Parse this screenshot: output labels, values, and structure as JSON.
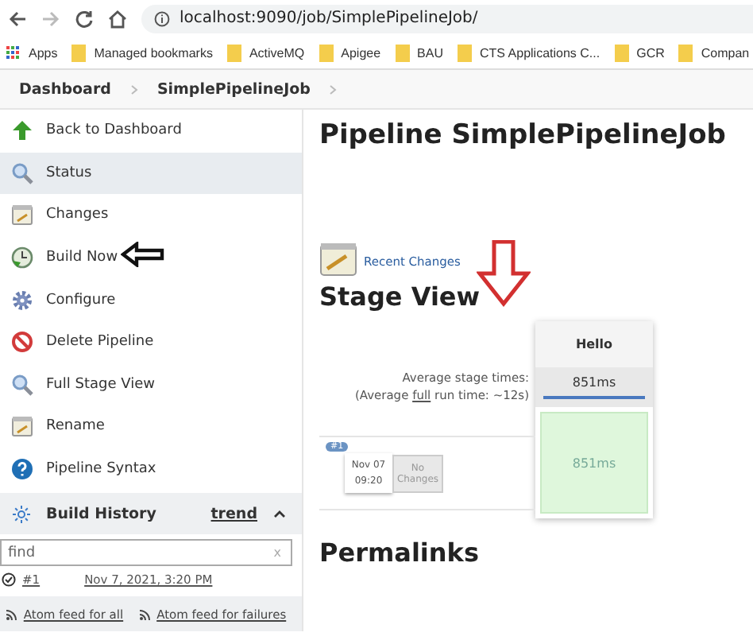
{
  "browser": {
    "url": "localhost:9090/job/SimplePipelineJob/"
  },
  "bookmarks": [
    {
      "label": "Apps",
      "kind": "apps"
    },
    {
      "label": "Managed bookmarks",
      "kind": "folder"
    },
    {
      "label": "ActiveMQ",
      "kind": "folder"
    },
    {
      "label": "Apigee",
      "kind": "folder"
    },
    {
      "label": "BAU",
      "kind": "folder"
    },
    {
      "label": "CTS Applications C...",
      "kind": "folder"
    },
    {
      "label": "GCR",
      "kind": "folder"
    },
    {
      "label": "Compan",
      "kind": "folder"
    }
  ],
  "breadcrumbs": [
    "Dashboard",
    "SimplePipelineJob"
  ],
  "sidebar": {
    "items": [
      {
        "label": "Back to Dashboard",
        "kind": "up",
        "selected": false
      },
      {
        "label": "Status",
        "kind": "search",
        "selected": true
      },
      {
        "label": "Changes",
        "kind": "notepad",
        "selected": false
      },
      {
        "label": "Build Now",
        "kind": "build",
        "selected": false
      },
      {
        "label": "Configure",
        "kind": "gear",
        "selected": false
      },
      {
        "label": "Delete Pipeline",
        "kind": "delete",
        "selected": false
      },
      {
        "label": "Full Stage View",
        "kind": "search",
        "selected": false
      },
      {
        "label": "Rename",
        "kind": "notepad",
        "selected": false
      },
      {
        "label": "Pipeline Syntax",
        "kind": "help",
        "selected": false
      }
    ]
  },
  "build_history": {
    "title": "Build History",
    "trend": "trend",
    "search": {
      "placeholder": "find",
      "clear": "x"
    },
    "builds": [
      {
        "number": "#1",
        "date": "Nov 7, 2021, 3:20 PM"
      }
    ],
    "feeds": [
      "Atom feed for all",
      "Atom feed for failures"
    ]
  },
  "main": {
    "title": "Pipeline SimplePipelineJob",
    "recent_changes": "Recent Changes",
    "stage_view_title": "Stage View",
    "stage": {
      "name": "Hello",
      "avg_label": "Average stage times:",
      "avg_run": [
        "(Average ",
        "full",
        " run time: ~12s)"
      ],
      "avg_time": "851ms",
      "run": {
        "badge": "#1",
        "date": "Nov 07",
        "time": "09:20",
        "changes": "No Changes",
        "duration": "851ms"
      }
    },
    "permalinks_title": "Permalinks"
  }
}
